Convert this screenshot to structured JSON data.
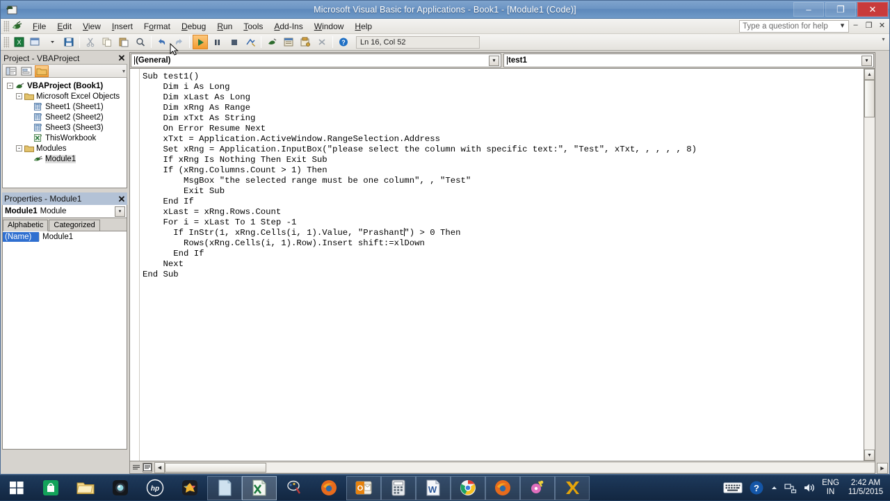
{
  "window": {
    "title": "Microsoft Visual Basic for Applications - Book1 - [Module1 (Code)]",
    "app_icon": "vba-document-icon",
    "controls": {
      "minimize": "–",
      "maximize": "❐",
      "close": "✕"
    }
  },
  "menubar": {
    "items": [
      {
        "label": "File",
        "accel": "F"
      },
      {
        "label": "Edit",
        "accel": "E"
      },
      {
        "label": "View",
        "accel": "V"
      },
      {
        "label": "Insert",
        "accel": "I"
      },
      {
        "label": "Format",
        "accel": "o"
      },
      {
        "label": "Debug",
        "accel": "D"
      },
      {
        "label": "Run",
        "accel": "R"
      },
      {
        "label": "Tools",
        "accel": "T"
      },
      {
        "label": "Add-Ins",
        "accel": "A"
      },
      {
        "label": "Window",
        "accel": "W"
      },
      {
        "label": "Help",
        "accel": "H"
      }
    ],
    "help_box_placeholder": "Type a question for help",
    "mdi_buttons": [
      "▾",
      "–",
      "❐",
      "✕"
    ]
  },
  "toolbar": {
    "buttons": [
      "view-excel-icon",
      "insert-userform-icon",
      "save-icon",
      "cut-icon",
      "copy-icon",
      "paste-icon",
      "find-icon",
      "undo-icon",
      "redo-icon",
      "run-sub-icon",
      "break-icon",
      "reset-icon",
      "design-mode-icon",
      "project-explorer-icon",
      "properties-window-icon",
      "object-browser-icon",
      "toolbox-icon",
      "help-icon"
    ],
    "active_button": "run-sub-icon",
    "status": "Ln 16, Col 52",
    "overflow": "▾"
  },
  "project_pane": {
    "title": "Project - VBAProject",
    "close_label": "✕",
    "toolbar_buttons": [
      "view-code-icon",
      "view-object-icon",
      "toggle-folders-icon"
    ],
    "selected_toolbar_button": "toggle-folders-icon",
    "tree": [
      {
        "label": "VBAProject (Book1)",
        "level": 0,
        "icon": "vba-project-icon",
        "twisty": "-",
        "bold": true,
        "selected": false
      },
      {
        "label": "Microsoft Excel Objects",
        "level": 1,
        "icon": "folder-icon",
        "twisty": "-",
        "bold": false,
        "selected": false
      },
      {
        "label": "Sheet1 (Sheet1)",
        "level": 2,
        "icon": "worksheet-icon",
        "twisty": "",
        "bold": false,
        "selected": false
      },
      {
        "label": "Sheet2 (Sheet2)",
        "level": 2,
        "icon": "worksheet-icon",
        "twisty": "",
        "bold": false,
        "selected": false
      },
      {
        "label": "Sheet3 (Sheet3)",
        "level": 2,
        "icon": "worksheet-icon",
        "twisty": "",
        "bold": false,
        "selected": false
      },
      {
        "label": "ThisWorkbook",
        "level": 2,
        "icon": "workbook-icon",
        "twisty": "",
        "bold": false,
        "selected": false
      },
      {
        "label": "Modules",
        "level": 1,
        "icon": "folder-icon",
        "twisty": "-",
        "bold": false,
        "selected": false
      },
      {
        "label": "Module1",
        "level": 2,
        "icon": "module-icon",
        "twisty": "",
        "bold": false,
        "selected": true
      }
    ]
  },
  "properties_pane": {
    "title": "Properties - Module1",
    "close_label": "✕",
    "object_name": "Module1",
    "object_type": "Module",
    "combo_arrow": "▾",
    "tabs": [
      {
        "label": "Alphabetic",
        "active": true
      },
      {
        "label": "Categorized",
        "active": false
      }
    ],
    "rows": [
      {
        "key": "(Name)",
        "value": "Module1"
      }
    ]
  },
  "code_window": {
    "object_combo": "(General)",
    "procedure_combo": "test1",
    "combo_arrow": "▾",
    "code": "Sub test1()\n    Dim i As Long\n    Dim xLast As Long\n    Dim xRng As Range\n    Dim xTxt As String\n    On Error Resume Next\n    xTxt = Application.ActiveWindow.RangeSelection.Address\n    Set xRng = Application.InputBox(\"please select the column with specific text:\", \"Test\", xTxt, , , , , 8)\n    If xRng Is Nothing Then Exit Sub\n    If (xRng.Columns.Count > 1) Then\n        MsgBox \"the selected range must be one column\", , \"Test\"\n        Exit Sub\n    End If\n    xLast = xRng.Rows.Count\n    For i = xLast To 1 Step -1\n      If InStr(1, xRng.Cells(i, 1).Value, \"Prashant",
    "code_after_cursor": "\") > 0 Then\n        Rows(xRng.Cells(i, 1).Row).Insert shift:=xlDown\n      End If\n    Next\nEnd Sub",
    "scrollbar": {
      "up_arrow": "▲",
      "down_arrow": "▼",
      "left_arrow": "◀",
      "right_arrow": "▶"
    },
    "view_buttons": [
      "procedure-view-icon",
      "full-module-view-icon"
    ]
  },
  "taskbar": {
    "start_icon": "windows-start-icon",
    "items": [
      {
        "name": "store-icon",
        "state": "pinned"
      },
      {
        "name": "file-explorer-icon",
        "state": "pinned"
      },
      {
        "name": "camera-icon",
        "state": "pinned"
      },
      {
        "name": "hp-icon",
        "state": "pinned"
      },
      {
        "name": "photos-icon",
        "state": "pinned"
      },
      {
        "name": "notes-icon",
        "state": "open"
      },
      {
        "name": "excel-icon",
        "state": "active"
      },
      {
        "name": "paint-icon",
        "state": "pinned"
      },
      {
        "name": "firefox-icon",
        "state": "pinned"
      },
      {
        "name": "outlook-icon",
        "state": "open"
      },
      {
        "name": "calculator-icon",
        "state": "open"
      },
      {
        "name": "word-icon",
        "state": "open"
      },
      {
        "name": "chrome-icon",
        "state": "open"
      },
      {
        "name": "firefox-window-icon",
        "state": "open"
      },
      {
        "name": "media-icon",
        "state": "open"
      },
      {
        "name": "xodo-icon",
        "state": "open"
      }
    ],
    "tray": {
      "keyboard_icon": "keyboard-icon",
      "help_icon": "help-circle-icon",
      "show_hidden_icon": "▲",
      "network_icon": "network-icon",
      "volume_icon": "volume-icon",
      "language_line1": "ENG",
      "language_line2": "IN",
      "time": "2:42 AM",
      "date": "11/5/2015"
    }
  }
}
